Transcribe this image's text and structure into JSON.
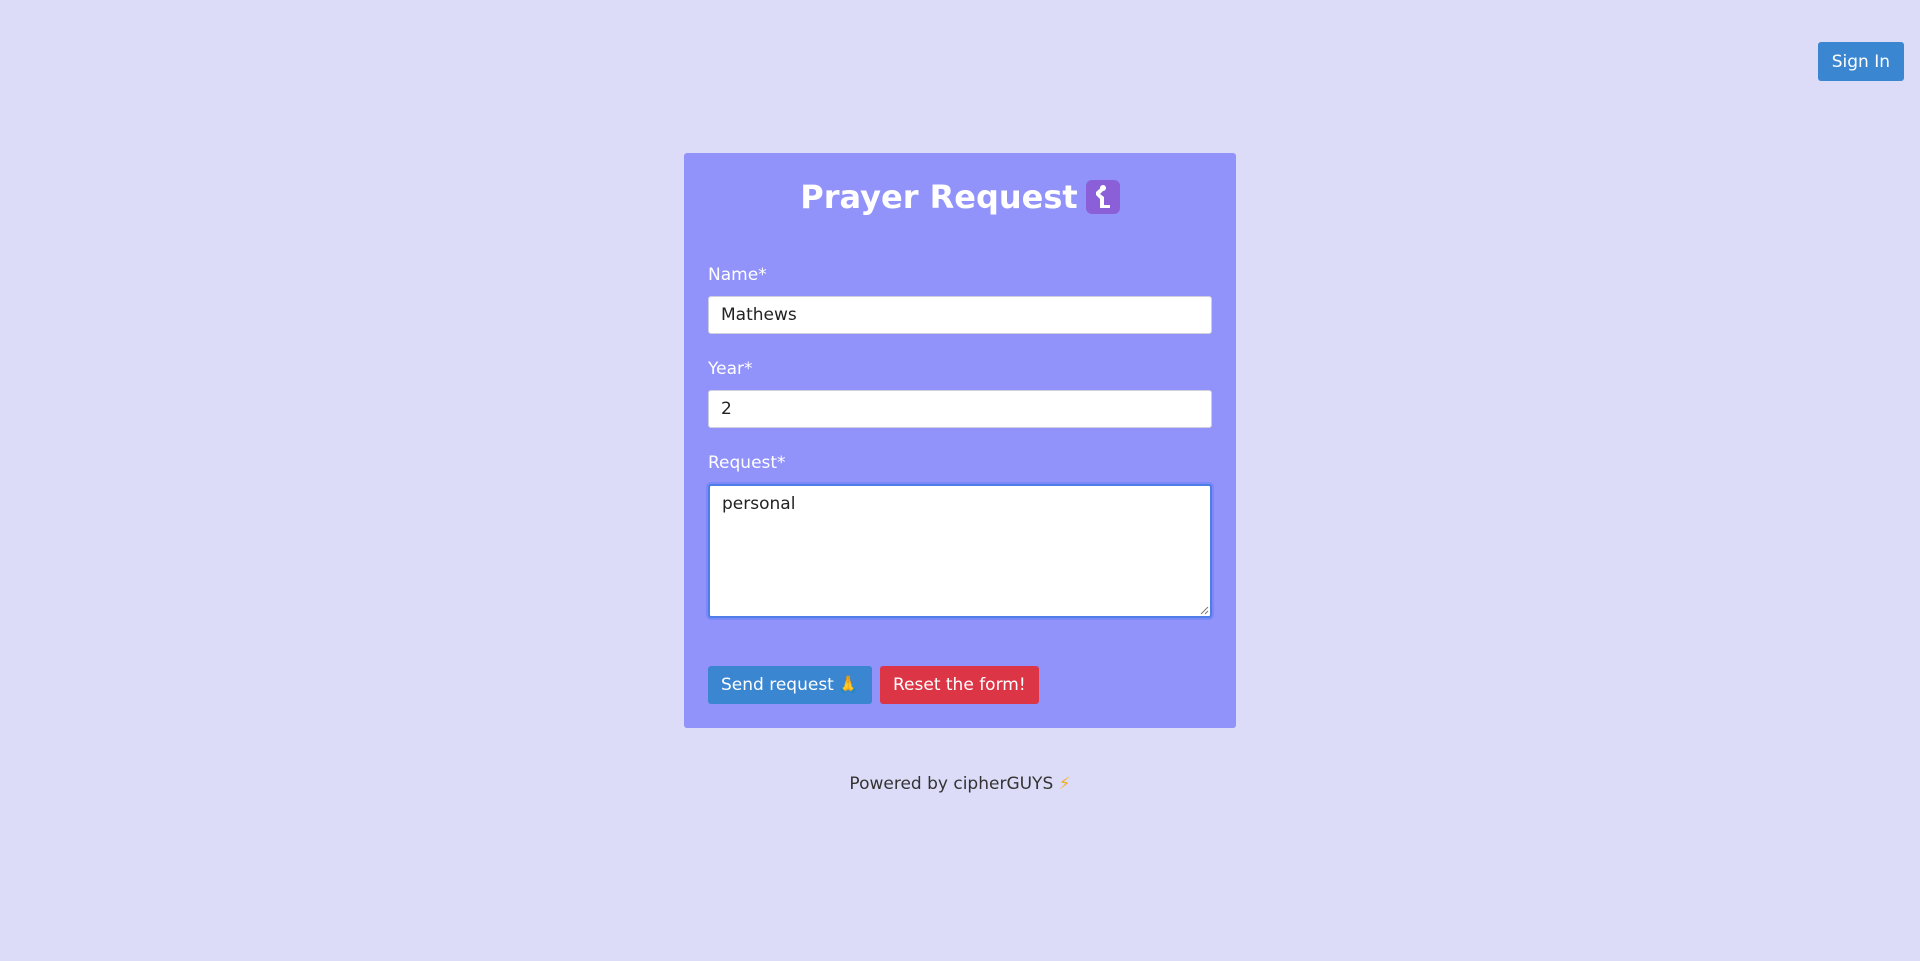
{
  "header": {
    "sign_in_label": "Sign In"
  },
  "form": {
    "title": "Prayer Request",
    "title_icon": "person-praying-icon",
    "fields": {
      "name": {
        "label": "Name*",
        "value": "Mathews"
      },
      "year": {
        "label": "Year*",
        "value": "2"
      },
      "request": {
        "label": "Request*",
        "value": "personal"
      }
    },
    "send_label": "Send request",
    "send_icon": "🙏",
    "reset_label": "Reset the form!"
  },
  "footer": {
    "text": "Powered by cipherGUYS",
    "icon": "⚡"
  },
  "colors": {
    "background": "#dcdcf8",
    "card": "#9193fb",
    "primary_button": "#3a86d1",
    "danger_button": "#dc3545"
  }
}
